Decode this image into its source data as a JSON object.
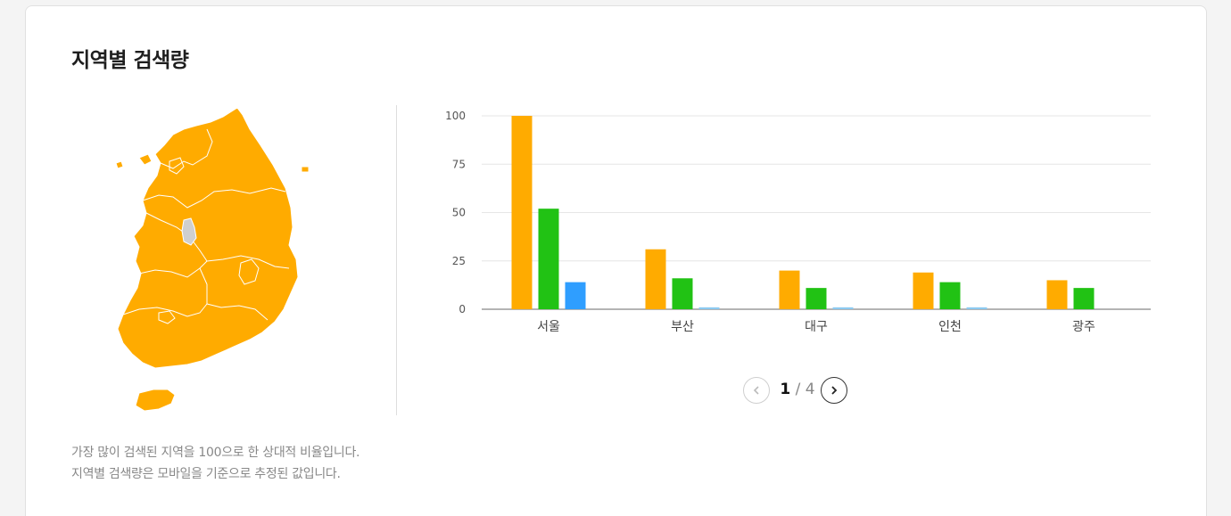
{
  "title": "지역별 검색량",
  "colors": {
    "series1": "#ffab00",
    "series2": "#21c214",
    "series3": "#2f9eff",
    "map_fill": "#ffab00",
    "map_highlight": "#cfcfcf"
  },
  "chart_data": {
    "type": "bar",
    "categories": [
      "서울",
      "부산",
      "대구",
      "인천",
      "광주"
    ],
    "series": [
      {
        "values": [
          100,
          31,
          20,
          19,
          15
        ]
      },
      {
        "values": [
          52,
          16,
          11,
          14,
          11
        ]
      },
      {
        "values": [
          14,
          1,
          1,
          1,
          0
        ]
      }
    ],
    "yticks": [
      0,
      25,
      50,
      75,
      100
    ],
    "ylim": [
      0,
      100
    ],
    "grid": true,
    "title": "",
    "xlabel": "",
    "ylabel": ""
  },
  "pagination": {
    "current": "1",
    "separator": "/",
    "total": "4"
  },
  "notes": [
    "가장 많이 검색된 지역을 100으로 한 상대적 비율입니다.",
    "지역별 검색량은 모바일을 기준으로 추정된 값입니다."
  ]
}
